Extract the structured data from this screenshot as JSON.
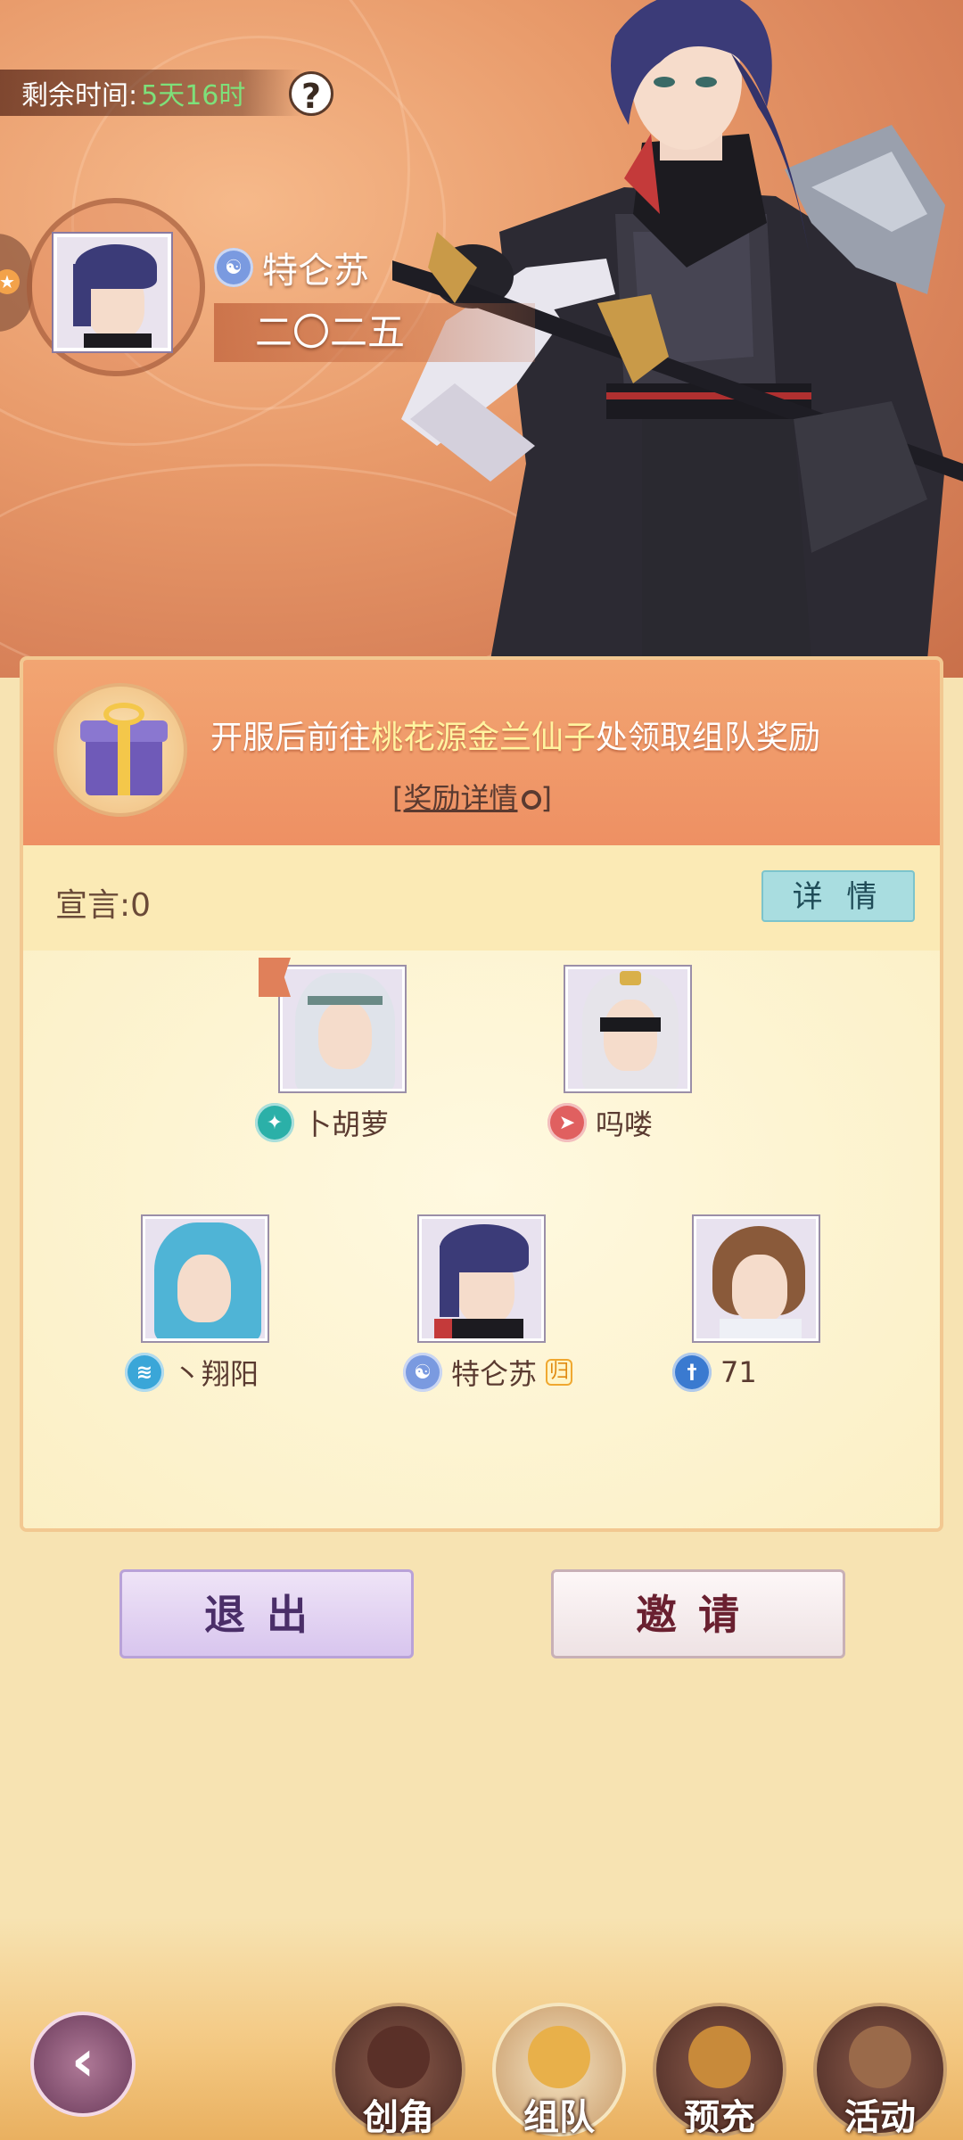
{
  "timer": {
    "label": "剩余时间:",
    "value": "5天16时"
  },
  "leader": {
    "name": "特仑苏",
    "team_name": "二〇二五"
  },
  "reward_banner": {
    "prefix": "开服后前往",
    "highlight": "桃花源金兰仙子",
    "suffix": "处领取组队奖励",
    "details_link": "[奖励详情"
  },
  "declaration": {
    "label": "宣言:0",
    "details_button": "详 情"
  },
  "members": [
    {
      "name": "卜胡萝",
      "sect_color": "#2bb0a8",
      "is_leader": true
    },
    {
      "name": "吗喽",
      "sect_color": "#e06060",
      "is_leader": false
    },
    {
      "name": "丶翔阳",
      "sect_color": "#3aa6d8",
      "is_leader": false
    },
    {
      "name": "特仑苏",
      "sect_color": "#7a9ae0",
      "is_leader": false,
      "badge": "归"
    },
    {
      "name": "71",
      "sect_color": "#3a7ad0",
      "is_leader": false
    }
  ],
  "buttons": {
    "exit": "退出",
    "invite": "邀请"
  },
  "nav": [
    {
      "label": "创角",
      "active": false
    },
    {
      "label": "组队",
      "active": true
    },
    {
      "label": "预充",
      "active": false
    },
    {
      "label": "活动",
      "active": false
    }
  ]
}
